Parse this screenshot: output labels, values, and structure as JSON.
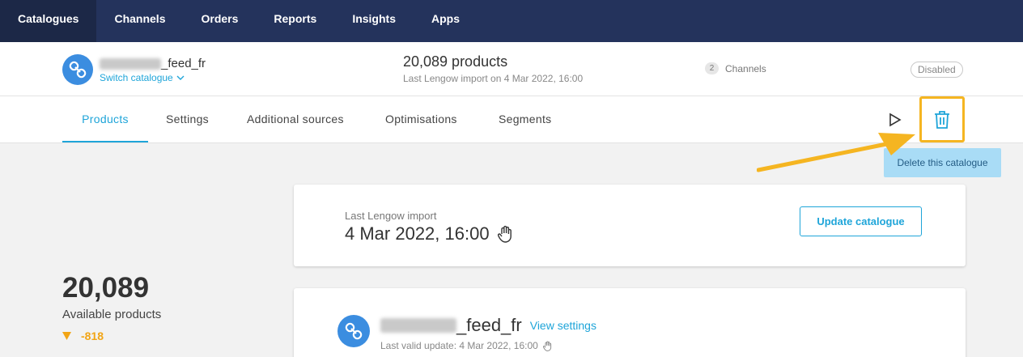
{
  "nav": {
    "items": [
      "Catalogues",
      "Channels",
      "Orders",
      "Reports",
      "Insights",
      "Apps"
    ],
    "active": "Catalogues"
  },
  "catalogue": {
    "name_suffix": "_feed_fr",
    "switch_label": "Switch catalogue",
    "product_count": "20,089 products",
    "last_import": "Last Lengow import on 4 Mar 2022, 16:00",
    "channels_count": "2",
    "channels_label": "Channels",
    "status": "Disabled"
  },
  "tabs": [
    "Products",
    "Settings",
    "Additional sources",
    "Optimisations",
    "Segments"
  ],
  "tooltip": "Delete this catalogue",
  "stats": {
    "available_count": "20,089",
    "available_label": "Available products",
    "delta": "-818"
  },
  "import_card": {
    "label": "Last Lengow import",
    "value": "4 Mar 2022, 16:00",
    "button": "Update catalogue"
  },
  "feed_card": {
    "name_suffix": "_feed_fr",
    "view_settings": "View settings",
    "last_update": "Last valid update: 4 Mar 2022, 16:00"
  },
  "colors": {
    "nav_bg": "#24335c",
    "accent": "#1fa5d9",
    "highlight": "#f5b521",
    "delta": "#f2a516"
  }
}
